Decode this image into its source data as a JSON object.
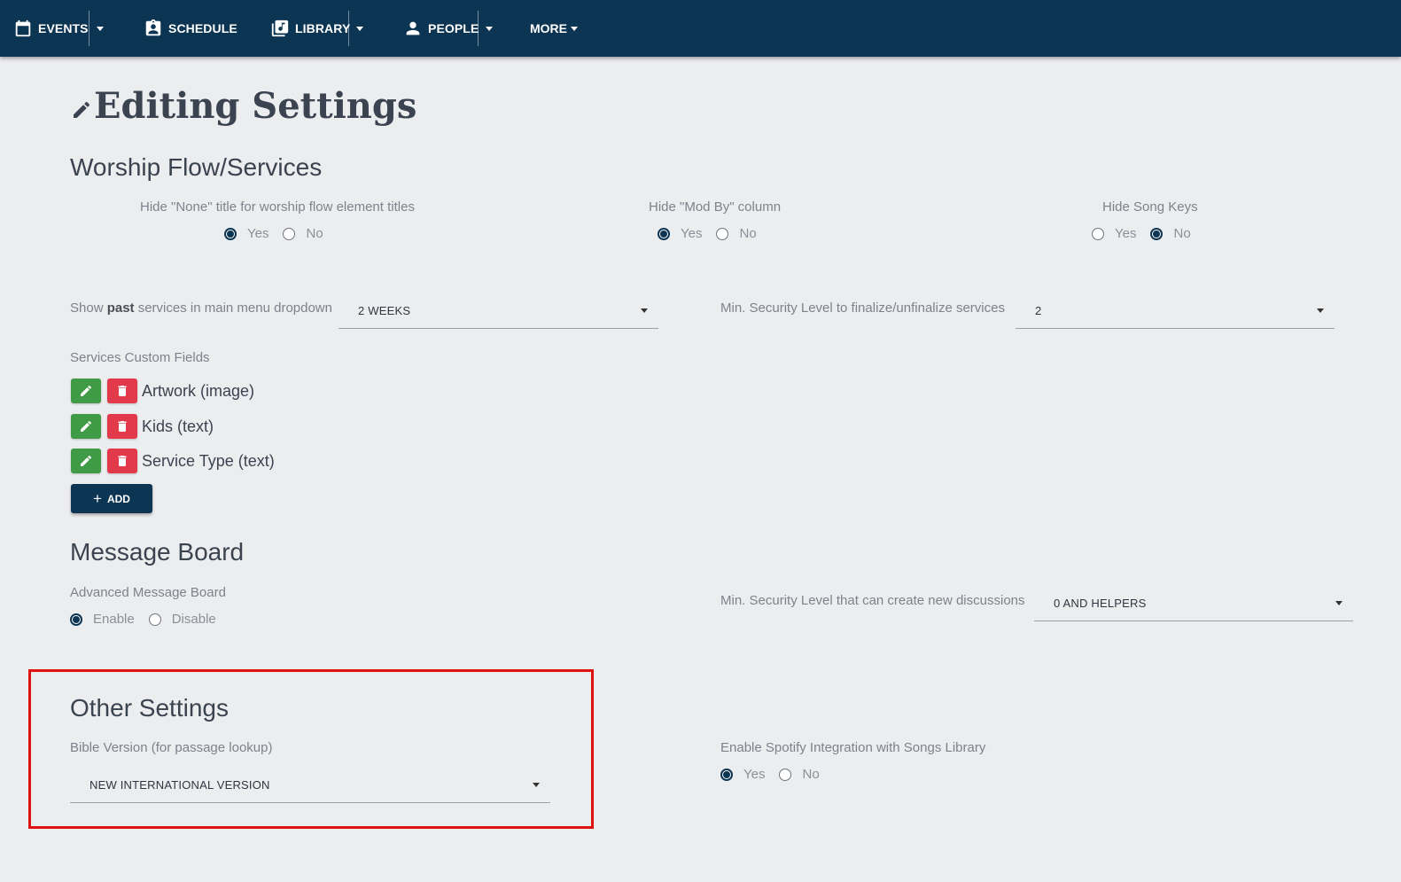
{
  "nav": {
    "events": "EVENTS",
    "schedule": "SCHEDULE",
    "library": "LIBRARY",
    "people": "PEOPLE",
    "more": "MORE"
  },
  "page_title": "Editing Settings",
  "worship": {
    "heading": "Worship Flow/Services",
    "hide_none": {
      "label": "Hide \"None\" title for worship flow element titles",
      "yes": "Yes",
      "no": "No",
      "selected": "Yes"
    },
    "hide_modby": {
      "label": "Hide \"Mod By\" column",
      "yes": "Yes",
      "no": "No",
      "selected": "Yes"
    },
    "hide_keys": {
      "label": "Hide Song Keys",
      "yes": "Yes",
      "no": "No",
      "selected": "No"
    },
    "past_label_pre": "Show ",
    "past_label_bold": "past",
    "past_label_post": " services in main menu dropdown",
    "past_value": "2 WEEKS",
    "finalize_label": "Min. Security Level to finalize/unfinalize services",
    "finalize_value": "2",
    "custom_fields_label": "Services Custom Fields",
    "custom_fields": [
      {
        "name": "Artwork (image)"
      },
      {
        "name": "Kids (text)"
      },
      {
        "name": "Service Type (text)"
      }
    ],
    "add_label": "ADD"
  },
  "message_board": {
    "heading": "Message Board",
    "advanced_label": "Advanced Message Board",
    "enable": "Enable",
    "disable": "Disable",
    "selected": "Enable",
    "discussion_label": "Min. Security Level that can create new discussions",
    "discussion_value": "0 AND HELPERS"
  },
  "other": {
    "heading": "Other Settings",
    "bible_label": "Bible Version (for passage lookup)",
    "bible_value": "NEW INTERNATIONAL VERSION",
    "spotify_label": "Enable Spotify Integration with Songs Library",
    "yes": "Yes",
    "no": "No",
    "selected": "Yes"
  },
  "colors": {
    "nav_bg": "#0c3453",
    "edit_btn": "#3f9b45",
    "delete_btn": "#e23a4a",
    "highlight": "#e01111"
  }
}
